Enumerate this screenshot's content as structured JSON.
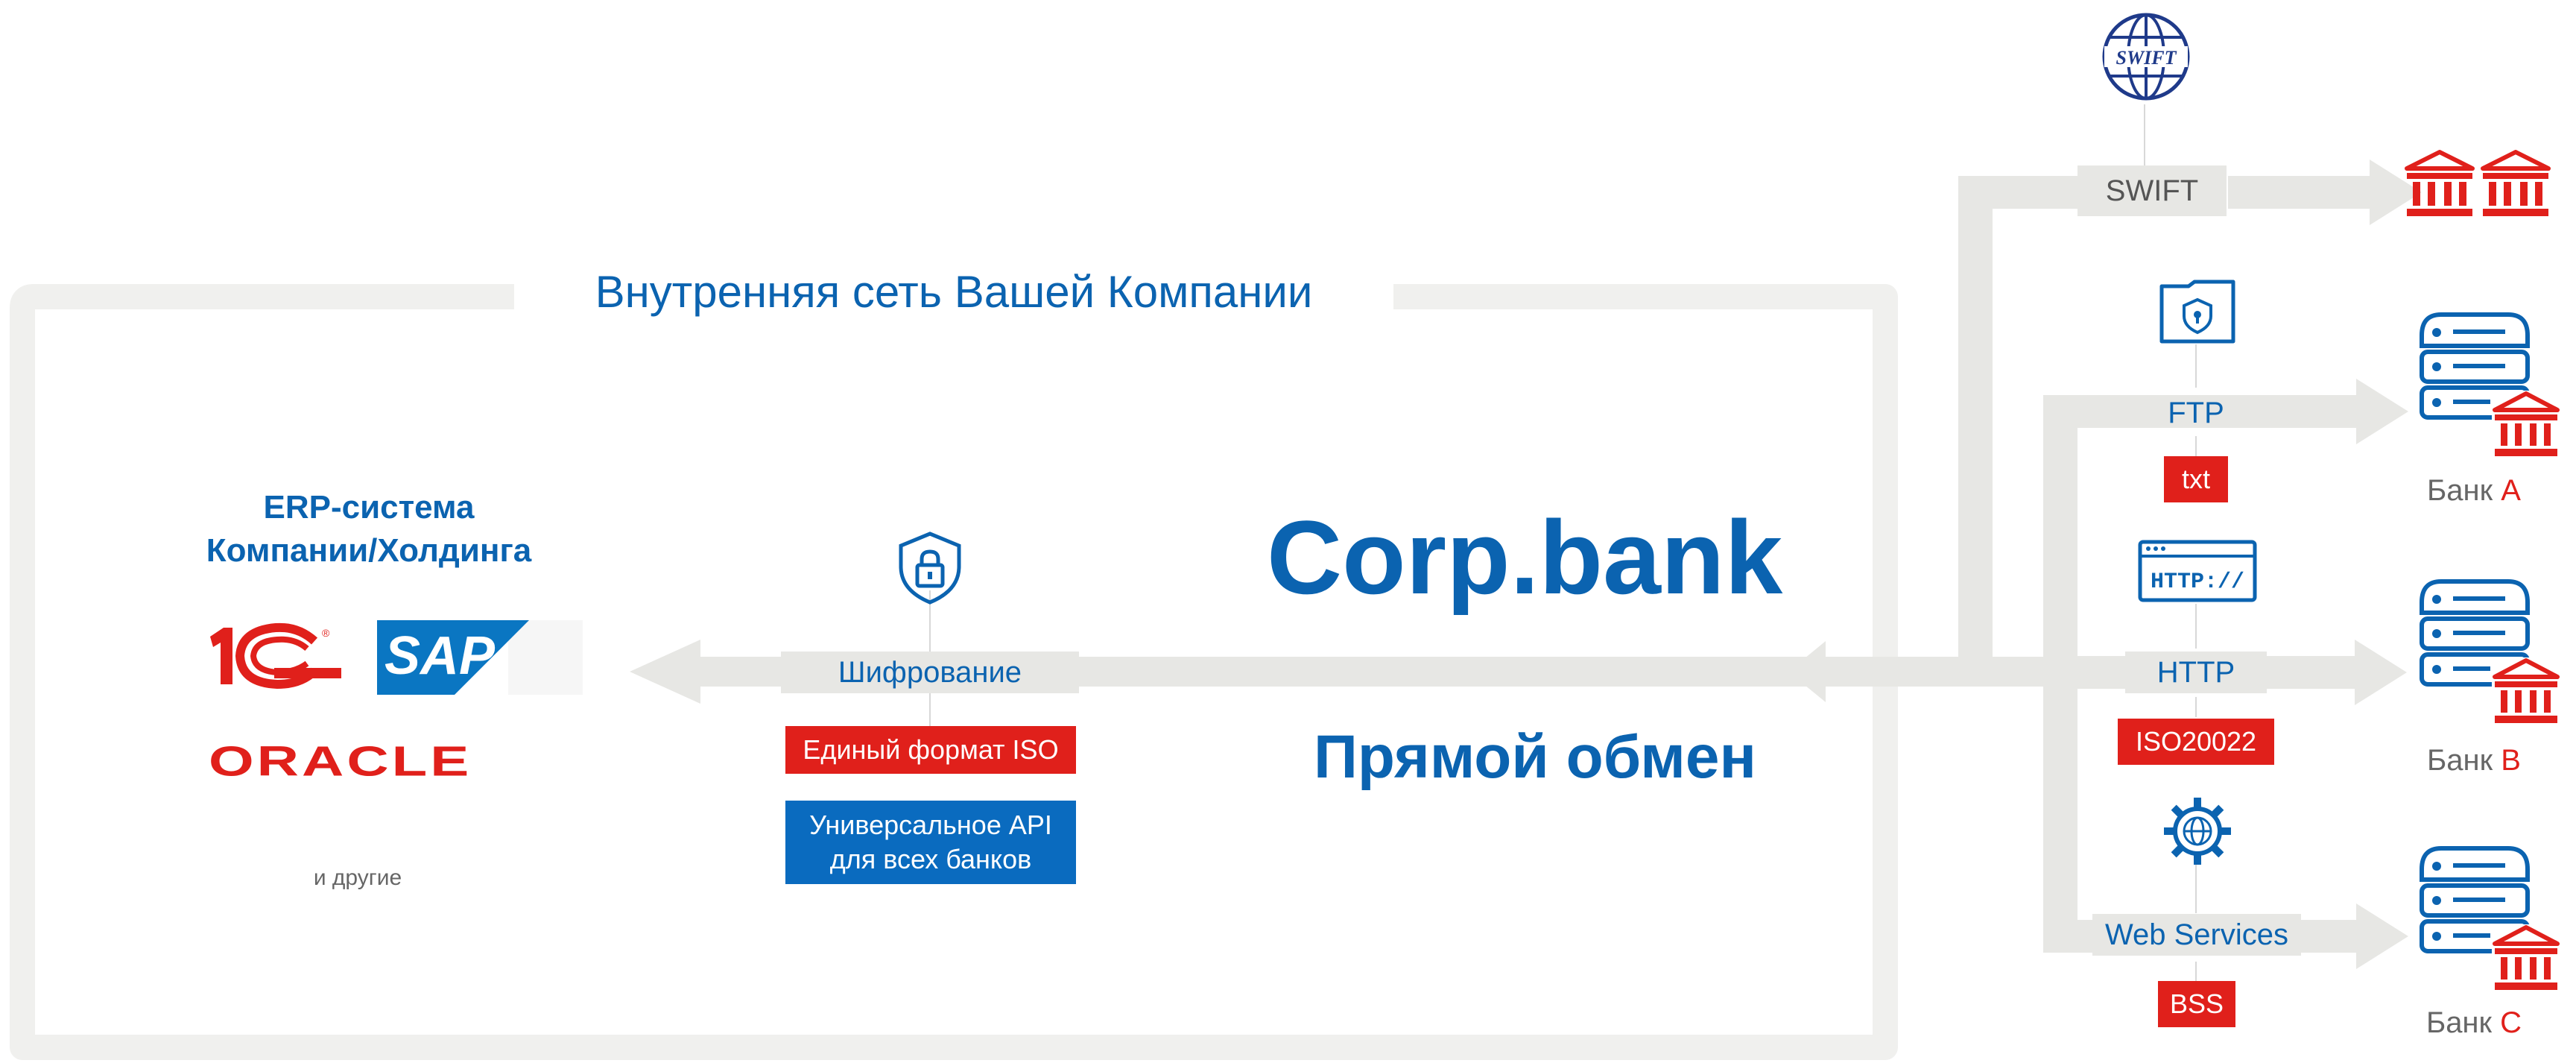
{
  "network_label": "Внутренняя сеть Вашей Компании",
  "erp": {
    "title_line1": "ERP-система",
    "title_line2": "Компании/Холдинга",
    "logos": {
      "onec": "1С",
      "sap": "SAP",
      "oracle": "ORACLE"
    },
    "others": "и другие"
  },
  "security": {
    "label": "Шифрование",
    "format_badge": "Единый формат ISO",
    "api_line1": "Универсальное API",
    "api_line2": "для всех банков"
  },
  "brand": {
    "name": "Corp.bank",
    "tagline": "Прямой обмен"
  },
  "channels": {
    "swift": {
      "label": "SWIFT",
      "logo": "SWIFT"
    },
    "ftp": {
      "label": "FTP",
      "format": "txt"
    },
    "http": {
      "label": "HTTP",
      "format": "ISO20022",
      "window_text": "HTTP://"
    },
    "ws": {
      "label": "Web Services",
      "format": "BSS"
    }
  },
  "banks": {
    "a": {
      "prefix": "Банк",
      "letter": "A"
    },
    "b": {
      "prefix": "Банк",
      "letter": "B"
    },
    "c": {
      "prefix": "Банк",
      "letter": "C"
    }
  },
  "colors": {
    "primary": "#0b63b0",
    "accent": "#e0201b",
    "arrow": "#e7e7e4",
    "frame": "#f0f0ee"
  }
}
